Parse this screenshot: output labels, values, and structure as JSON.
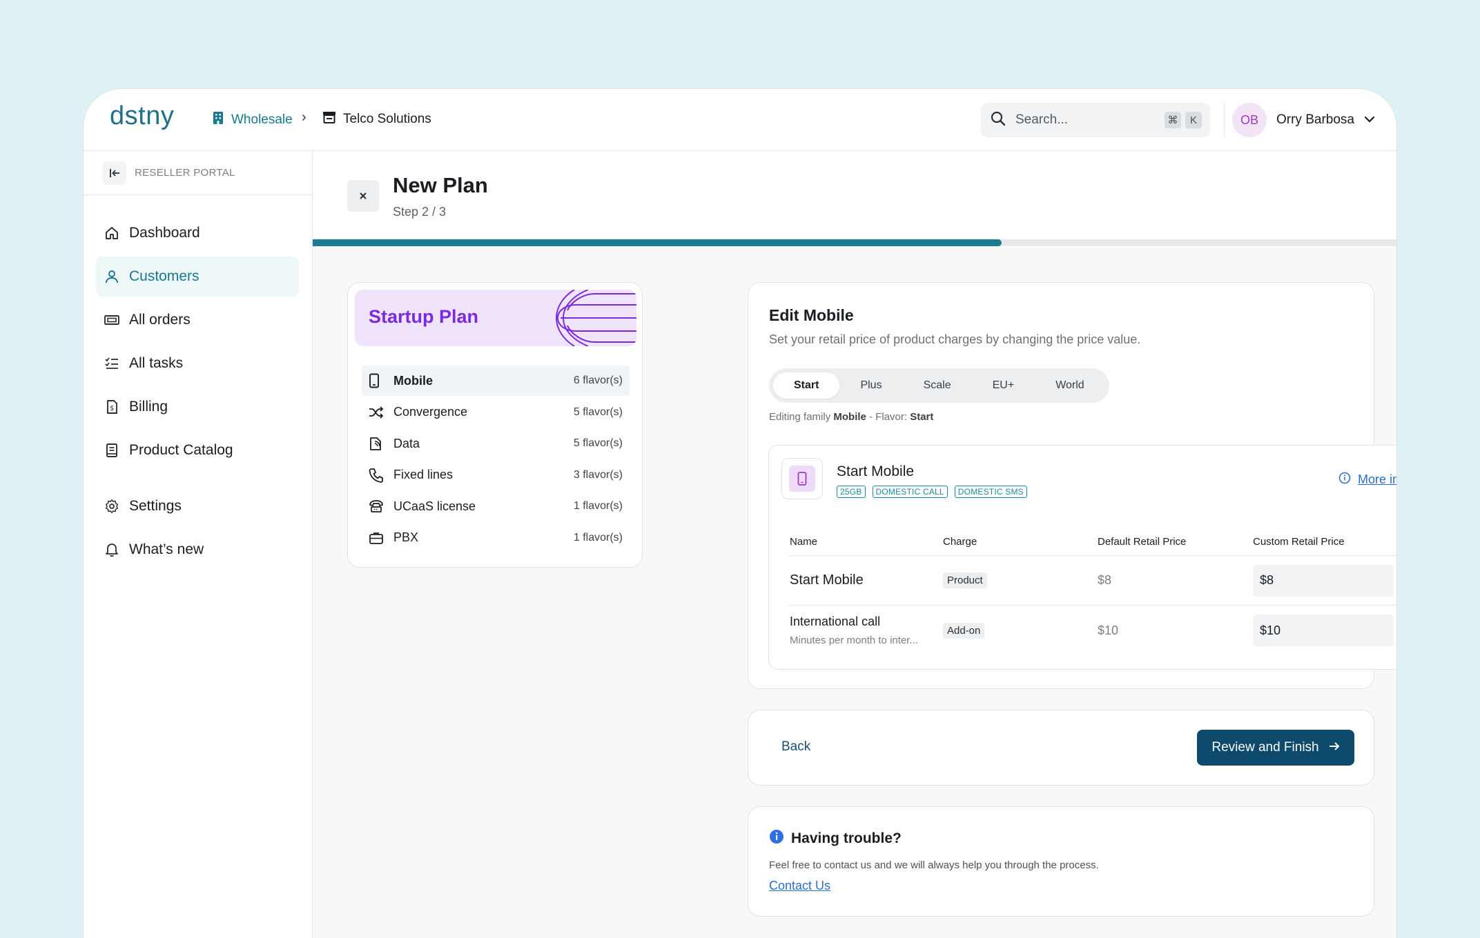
{
  "brand": {
    "logo_text": "dstny",
    "color": "#1f6f86"
  },
  "breadcrumb": {
    "items": [
      {
        "label": "Wholesale",
        "icon": "building-icon"
      },
      {
        "label": "Telco Solutions",
        "icon": "store-icon"
      }
    ]
  },
  "search": {
    "placeholder": "Search...",
    "shortcut_cmd": "⌘",
    "shortcut_key": "K"
  },
  "user": {
    "initials": "OB",
    "name": "Orry Barbosa"
  },
  "sidebar": {
    "portal_label": "RESELLER PORTAL",
    "items": [
      {
        "label": "Dashboard",
        "icon": "home-icon",
        "active": false
      },
      {
        "label": "Customers",
        "icon": "user-icon",
        "active": true
      },
      {
        "label": "All orders",
        "icon": "ticket-icon",
        "active": false
      },
      {
        "label": "All tasks",
        "icon": "checklist-icon",
        "active": false
      },
      {
        "label": "Billing",
        "icon": "invoice-icon",
        "active": false
      },
      {
        "label": "Product Catalog",
        "icon": "catalog-icon",
        "active": false
      },
      {
        "label": "Settings",
        "icon": "gear-icon",
        "active": false
      },
      {
        "label": "What’s new",
        "icon": "bell-icon",
        "active": false
      }
    ]
  },
  "page": {
    "title": "New Plan",
    "step": "Step 2 / 3",
    "progress": 0.635
  },
  "plan": {
    "name": "Startup Plan",
    "families": [
      {
        "name": "Mobile",
        "count": "6 flavor(s)",
        "icon": "phone-icon",
        "selected": true
      },
      {
        "name": "Convergence",
        "count": "5 flavor(s)",
        "icon": "shuffle-icon",
        "selected": false
      },
      {
        "name": "Data",
        "count": "5 flavor(s)",
        "icon": "data-icon",
        "selected": false
      },
      {
        "name": "Fixed lines",
        "count": "3 flavor(s)",
        "icon": "handset-icon",
        "selected": false
      },
      {
        "name": "UCaaS license",
        "count": "1 flavor(s)",
        "icon": "ucaas-icon",
        "selected": false
      },
      {
        "name": "PBX",
        "count": "1 flavor(s)",
        "icon": "briefcase-icon",
        "selected": false
      }
    ]
  },
  "edit": {
    "title": "Edit Mobile",
    "subtitle": "Set your retail price of product charges by changing the price value.",
    "tabs": [
      "Start",
      "Plus",
      "Scale",
      "EU+",
      "World"
    ],
    "active_tab": "Start",
    "editing_prefix": "Editing family ",
    "editing_family": "Mobile",
    "editing_mid": " - Flavor: ",
    "editing_flavor": "Start",
    "product": {
      "name": "Start Mobile",
      "tags": [
        "25GB",
        "DOMESTIC CALL",
        "DOMESTIC SMS"
      ],
      "more_info": "More info",
      "columns": [
        "Name",
        "Charge",
        "Default Retail Price",
        "Custom Retail Price"
      ],
      "rows": [
        {
          "name": "Start Mobile",
          "desc": "",
          "charge": "Product",
          "default_price": "$8",
          "custom_price": "$8"
        },
        {
          "name": "International call",
          "desc": "Minutes per month to inter...",
          "charge": "Add-on",
          "default_price": "$10",
          "custom_price": "$10"
        }
      ]
    }
  },
  "actions": {
    "back": "Back",
    "finish": "Review and Finish"
  },
  "help": {
    "title": "Having trouble?",
    "text": "Feel free to contact us and we will always help you through the process.",
    "link": "Contact Us"
  }
}
